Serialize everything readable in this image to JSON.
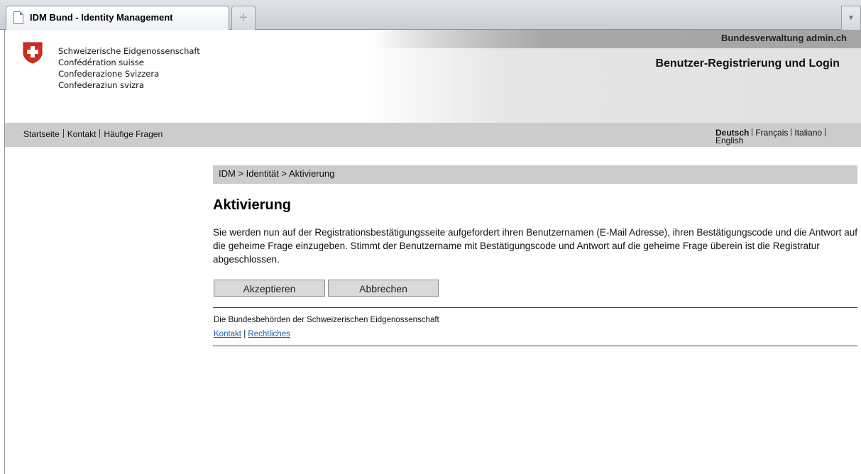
{
  "browser": {
    "tab_title": "IDM Bund - Identity Management",
    "newtab_icon": "plus-icon",
    "tab_menu_icon": "chevron-down-icon"
  },
  "header": {
    "topbar_text": "Bundesverwaltung admin.ch",
    "confederation": [
      "Schweizerische Eidgenossenschaft",
      "Confédération suisse",
      "Confederazione Svizzera",
      "Confederaziun svizra"
    ],
    "app_title": "Benutzer-Registrierung und Login",
    "crest_icon": "swiss-crest-icon",
    "crest_color": "#d52b1e"
  },
  "nav": {
    "items": [
      "Startseite",
      "Kontakt",
      "Häufige Fragen"
    ],
    "languages": [
      "Deutsch",
      "Français",
      "Italiano",
      "English"
    ],
    "active_language": "Deutsch"
  },
  "content": {
    "breadcrumb": "IDM > Identität > Aktivierung",
    "title": "Aktivierung",
    "intro": "Sie werden nun auf der Registrationsbestätigungsseite aufgefordert ihren Benutzernamen (E-Mail Adresse), ihren Bestätigungscode und die Antwort auf die geheime Frage einzugeben. Stimmt der Benutzername mit Bestätigungscode und Antwort auf die geheime Frage überein ist die Registratur abgeschlossen.",
    "accept_label": "Akzeptieren",
    "cancel_label": "Abbrechen"
  },
  "footer": {
    "text": "Die Bundesbehörden der Schweizerischen Eidgenossenschaft",
    "links": [
      "Kontakt",
      "Rechtliches"
    ],
    "link_separator": "|"
  }
}
